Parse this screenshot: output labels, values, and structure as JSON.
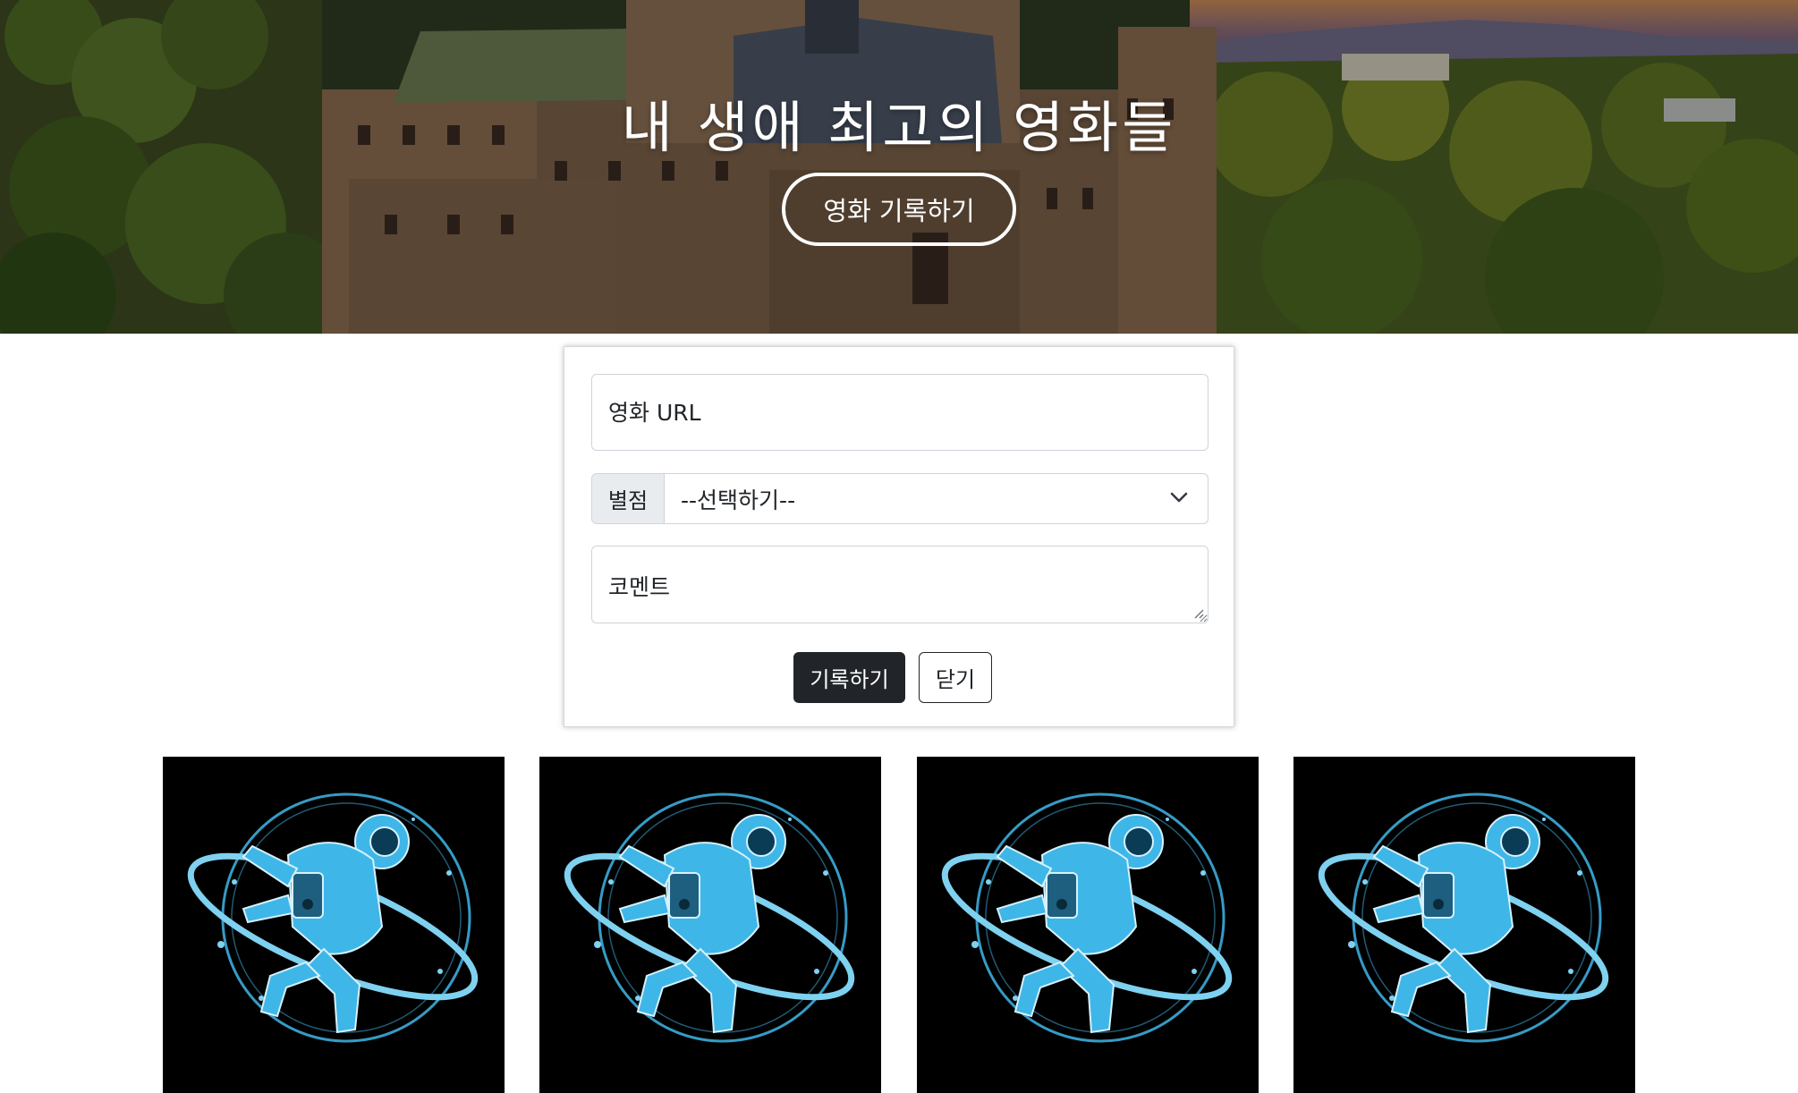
{
  "hero": {
    "title": "내 생애 최고의 영화들",
    "open_form_label": "영화 기록하기"
  },
  "form": {
    "url_placeholder": "영화 URL",
    "rating_label": "별점",
    "rating_selected": "--선택하기--",
    "comment_placeholder": "코멘트",
    "save_label": "기록하기",
    "close_label": "닫기"
  },
  "cards": [
    {
      "image": "astronaut-illustration"
    },
    {
      "image": "astronaut-illustration"
    },
    {
      "image": "astronaut-illustration"
    },
    {
      "image": "astronaut-illustration"
    }
  ],
  "colors": {
    "primary_dark": "#212529",
    "card_background": "#000000",
    "illustration_blue": "#3fb6e8"
  }
}
